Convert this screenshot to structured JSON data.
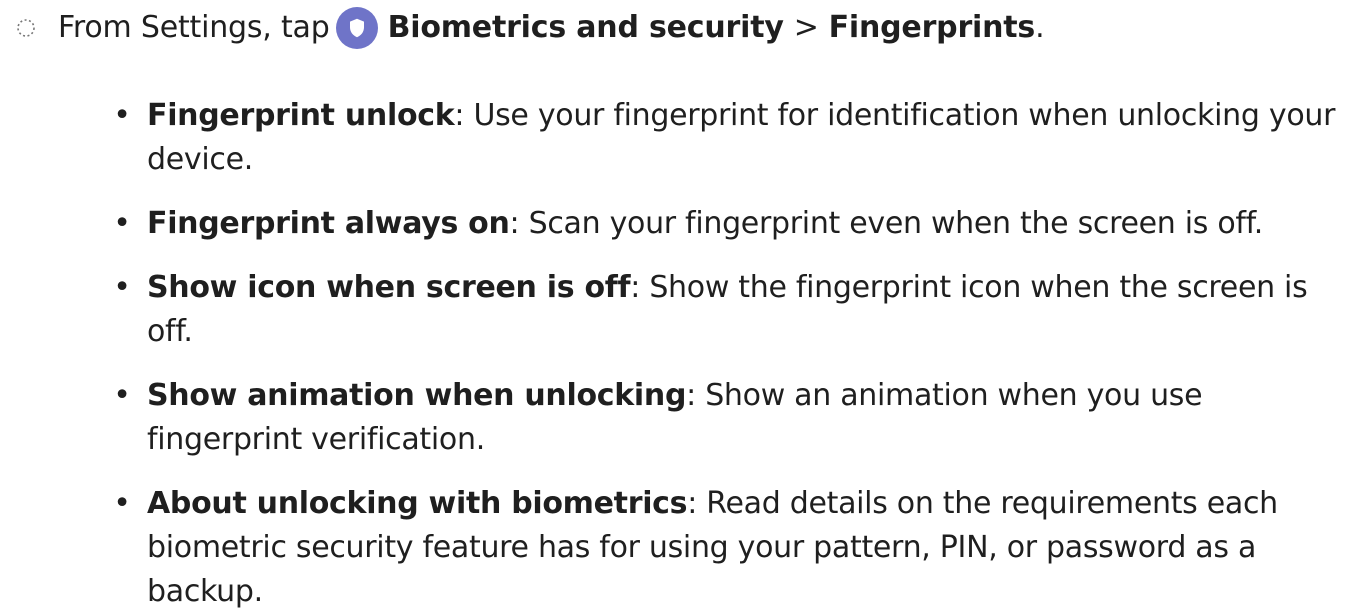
{
  "colors": {
    "text": "#1f1f1f",
    "security_icon_bg": "#6f74c8",
    "security_icon_fg": "#ffffff",
    "step_marker": "#777777"
  },
  "step": {
    "marker_icon": "dotted-circle-icon",
    "prefix": "From Settings, tap",
    "app_icon": "shield-icon",
    "menu": "Biometrics and security",
    "separator": ">",
    "submenu": "Fingerprints",
    "suffix": "."
  },
  "items": [
    {
      "bullet": "•",
      "term": "Fingerprint unlock",
      "colon": ":",
      "description": " Use your fingerprint for identification when unlocking your device."
    },
    {
      "bullet": "•",
      "term": "Fingerprint always on",
      "colon": ":",
      "description": " Scan your fingerprint even when the screen is off."
    },
    {
      "bullet": "•",
      "term": "Show icon when screen is off",
      "colon": ":",
      "description": " Show the fingerprint icon when the screen is off."
    },
    {
      "bullet": "•",
      "term": "Show animation when unlocking",
      "colon": ":",
      "description": " Show an animation when you use fingerprint verification."
    },
    {
      "bullet": "•",
      "term": "About unlocking with biometrics",
      "colon": ":",
      "description": " Read details on the requirements each biometric security feature has for using your pattern, PIN, or password as a backup."
    }
  ]
}
